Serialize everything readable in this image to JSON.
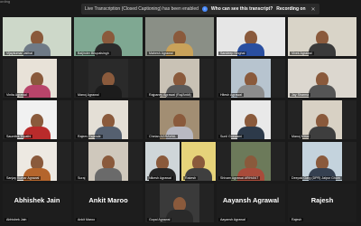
{
  "recording_label": "ording",
  "banner": {
    "message": "Live Transcription (Closed Captioning) has been enabled",
    "question": "Who can see this transcript?",
    "recording": "Recording on"
  },
  "tiles": [
    {
      "name": "Vijaykumar Jalihal",
      "bg": "#cdd8c9",
      "shirt": "#6f7a86",
      "active": true
    },
    {
      "name": "Baljinder Bhupalsingh",
      "bg": "#7fa892",
      "shirt": "#2b2b2b"
    },
    {
      "name": "Mahesh Agrawal",
      "bg": "#8a8f86",
      "shirt": "#c9a25a"
    },
    {
      "name": "Sandeep Singhal",
      "bg": "#e6e6e6",
      "shirt": "#2a4fa0"
    },
    {
      "name": "Vivek Agrawal",
      "bg": "#d9d4c8",
      "shirt": "#3a3a3a"
    },
    {
      "name": "Vinita Agrawal",
      "bg": "#e8e2d8",
      "shirt": "#b8446a"
    },
    {
      "name": "Manoj Agrawal",
      "bg": "#2a2a2a",
      "shirt": "#1c1c1c"
    },
    {
      "name": "Rajpaney Agrawal (Raj/Ankit)",
      "bg": "#c9c2b5",
      "shirt": "#5a5a5a"
    },
    {
      "name": "Hitesh Agrawal",
      "bg": "#b7c4cf",
      "shirt": "#8c8c8c"
    },
    {
      "name": "Jay Sharma",
      "bg": "#dcd7cf",
      "shirt": "#555555"
    },
    {
      "name": "Saumitra Tripathi",
      "bg": "#f1f1f1",
      "shirt": "#b92b2b"
    },
    {
      "name": "Rajeev Rajende",
      "bg": "#e4dfd6",
      "shirt": "#556070"
    },
    {
      "name": "Chetan AGRAWAL",
      "bg": "#a28e73",
      "shirt": "#b9b9c2"
    },
    {
      "name": "Sunil Goswami",
      "bg": "#e9e9e9",
      "shirt": "#2d3a4a"
    },
    {
      "name": "Manoj Mittal",
      "bg": "#d8d1c4",
      "shirt": "#3e3e3e"
    },
    {
      "name": "Sanjay Kumar Agrawal",
      "bg": "#ede9e2",
      "shirt": "#b4652c"
    },
    {
      "name": "Suraj",
      "bg": "#cfc8bc",
      "shirt": "#6a6a6a"
    },
    {
      "name": "Nikesh Agrawal",
      "bg": "#cfd6d9",
      "shirt": "#252525"
    },
    {
      "name": "Rakesh",
      "bg": "#e6d37a",
      "shirt": "#3f3f3f"
    },
    {
      "name": "Shivam Agrawal ARIHANT",
      "bg": "#6c7a5a",
      "shirt": "#a94b3a"
    },
    {
      "name": "Deepak Garg (DPR) Jaipur Ghum",
      "bg": "#c4d3dd",
      "shirt": "#354050"
    },
    {
      "name": "Abhishek Jain",
      "big": "Abhishek Jain"
    },
    {
      "name": "Ankit Maroo",
      "big": "Ankit Maroo"
    },
    {
      "name": "Gopal Agrawal",
      "bg": "#3a3a3a",
      "shirt": "#2a2a2a"
    },
    {
      "name": "Aayansh Agrawal",
      "big": "Aayansh Agrawal"
    },
    {
      "name": "Rajesh",
      "big": "Rajesh"
    }
  ]
}
